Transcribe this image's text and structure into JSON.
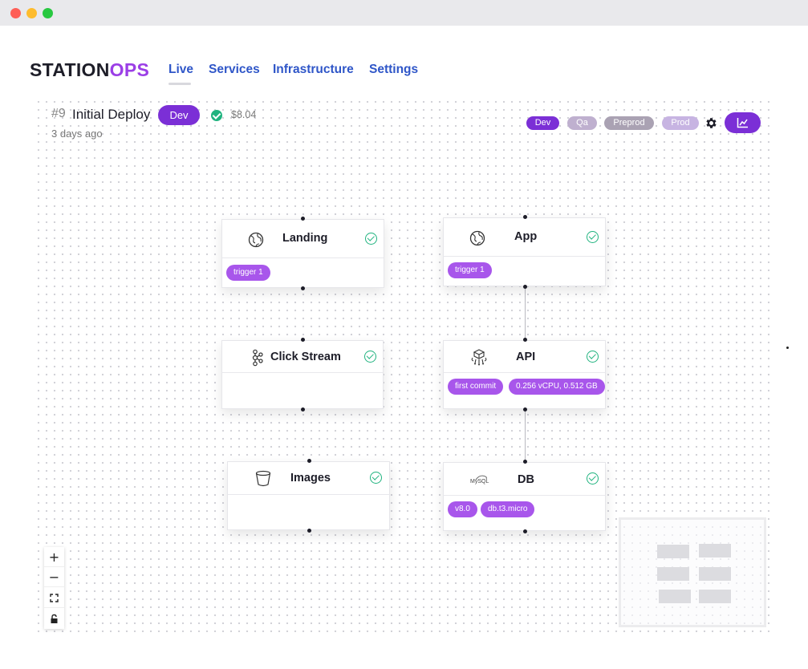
{
  "logo": {
    "part1": "STATION",
    "part2": "OPS"
  },
  "nav": {
    "tabs": [
      "Live",
      "Services",
      "Infrastructure",
      "Settings"
    ],
    "active": "Live"
  },
  "deploy": {
    "number": "#9",
    "title": "Initial Deploy",
    "env": "Dev",
    "cost": "$8.04",
    "time": "3 days ago"
  },
  "environments": [
    "Dev",
    "Qa",
    "Preprod",
    "Prod"
  ],
  "colors": {
    "accent": "#7b2fd6",
    "tag": "#a856eb",
    "success": "#20b37f",
    "nav": "#2f56c8"
  },
  "nodes": {
    "landing": {
      "title": "Landing",
      "icon": "globe-icon",
      "tags": [
        "trigger 1"
      ]
    },
    "app": {
      "title": "App",
      "icon": "globe-icon",
      "tags": [
        "trigger 1"
      ]
    },
    "clickstream": {
      "title": "Click Stream",
      "icon": "kafka-icon",
      "tags": []
    },
    "api": {
      "title": "API",
      "icon": "container-icon",
      "tags": [
        "first commit",
        "0.256 vCPU, 0.512 GB"
      ]
    },
    "images": {
      "title": "Images",
      "icon": "bucket-icon",
      "tags": []
    },
    "db": {
      "title": "DB",
      "icon": "mysql-icon",
      "icon_text": "MySQL",
      "tags": [
        "v8.0",
        "db.t3.micro"
      ]
    }
  },
  "controls": {
    "zoom_in": "+",
    "zoom_out": "−"
  }
}
